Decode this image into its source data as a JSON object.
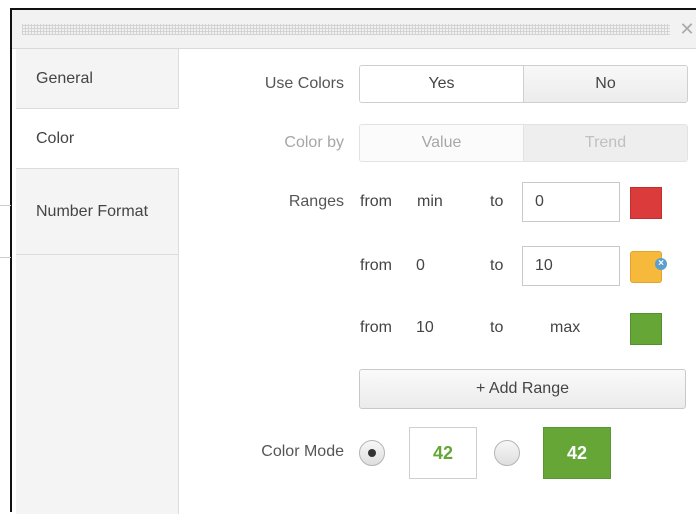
{
  "dialog": {
    "close_glyph": "✕"
  },
  "tabs": [
    {
      "label": "General"
    },
    {
      "label": "Color"
    },
    {
      "label": "Number Format"
    }
  ],
  "use_colors": {
    "label": "Use Colors",
    "options": [
      "Yes",
      "No"
    ],
    "selected": "Yes"
  },
  "color_by": {
    "label": "Color by",
    "options": [
      "Value",
      "Trend"
    ],
    "selected": "Value",
    "disabled": true
  },
  "ranges": {
    "label": "Ranges",
    "from_word": "from",
    "to_word": "to",
    "rows": [
      {
        "from": "min",
        "to": "0",
        "color": "#dc3b3b"
      },
      {
        "from": "0",
        "to": "10",
        "color": "#f6b93b",
        "removable": true
      },
      {
        "from": "10",
        "to": "max",
        "color": "#65a637"
      }
    ],
    "add_label": "+ Add Range"
  },
  "color_mode": {
    "label": "Color Mode",
    "options": [
      {
        "sample": "42",
        "style": "text-color",
        "selected": true
      },
      {
        "sample": "42",
        "style": "background-color",
        "selected": false
      }
    ]
  },
  "colors": {
    "accent_green": "#65a637",
    "remove_blue": "#5a9fce"
  }
}
